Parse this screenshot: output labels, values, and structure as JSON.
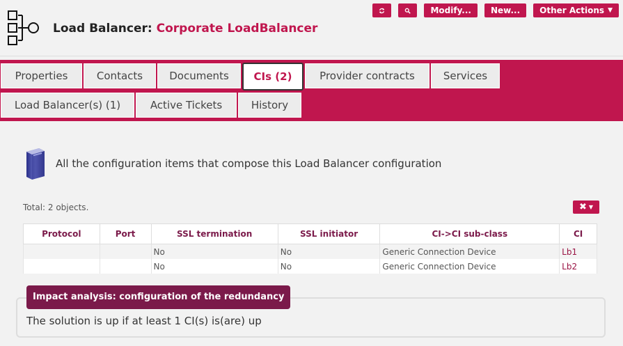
{
  "header": {
    "object_type": "Load Balancer:",
    "object_name": "Corporate LoadBalancer",
    "icon": "load-balancer-icon"
  },
  "actions": {
    "refresh_icon": "refresh-icon",
    "search_icon": "search-icon",
    "modify_label": "Modify...",
    "new_label": "New...",
    "other_actions_label": "Other Actions"
  },
  "tabs": [
    {
      "label": "Properties"
    },
    {
      "label": "Contacts"
    },
    {
      "label": "Documents"
    },
    {
      "label": "CIs (2)",
      "active": true
    },
    {
      "label": "Provider contracts"
    },
    {
      "label": "Services"
    },
    {
      "label": "Load Balancer(s) (1)"
    },
    {
      "label": "Active Tickets"
    },
    {
      "label": "History"
    }
  ],
  "intro": {
    "text": "All the configuration items that compose this Load Balancer configuration",
    "icon": "database-icon"
  },
  "list": {
    "total": "Total: 2 objects.",
    "columns": [
      "Protocol",
      "Port",
      "SSL termination",
      "SSL initiator",
      "CI->CI sub-class",
      "CI"
    ],
    "rows": [
      {
        "protocol": "",
        "port": "",
        "ssl_termination": "No",
        "ssl_initiator": "No",
        "subclass": "Generic Connection Device",
        "ci": "Lb1"
      },
      {
        "protocol": "",
        "port": "",
        "ssl_termination": "No",
        "ssl_initiator": "No",
        "subclass": "Generic Connection Device",
        "ci": "Lb2"
      }
    ]
  },
  "impact": {
    "title": "Impact analysis: configuration of the redundancy",
    "text": "The solution is up if at least 1 CI(s) is(are) up"
  },
  "colors": {
    "brand": "#c0164e",
    "dark_accent": "#7b1a4a"
  }
}
